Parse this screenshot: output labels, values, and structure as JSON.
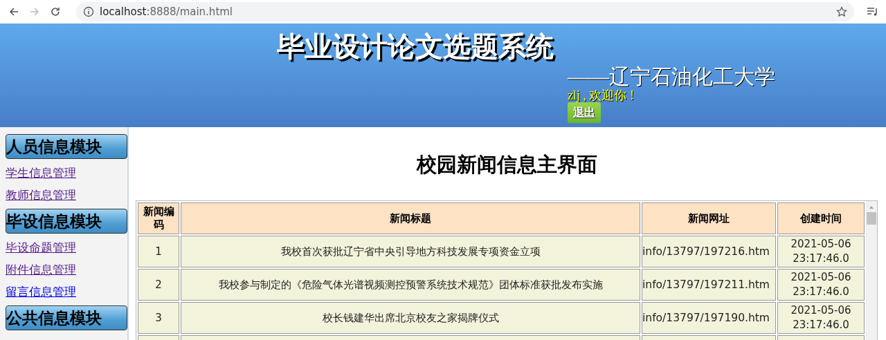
{
  "browser": {
    "url_host": "localhost",
    "url_rest": ":8888/main.html"
  },
  "header": {
    "title": "毕业设计论文选题系统",
    "subtitle": "——辽宁石油化工大学",
    "welcome": "zlj , 欢迎你 !",
    "logout": "退出"
  },
  "sidebar": {
    "sections": [
      {
        "heading": "人员信息模块",
        "links": [
          {
            "label": "学生信息管理",
            "visited": true
          },
          {
            "label": "教师信息管理",
            "visited": true
          }
        ]
      },
      {
        "heading": "毕设信息模块",
        "links": [
          {
            "label": "毕设命题管理",
            "visited": true
          },
          {
            "label": "附件信息管理",
            "visited": true
          },
          {
            "label": "留言信息管理",
            "visited": false
          }
        ]
      },
      {
        "heading": "公共信息模块"
      }
    ]
  },
  "main": {
    "title": "校园新闻信息主界面",
    "table": {
      "columns": [
        "新闻编码",
        "新闻标题",
        "新闻网址",
        "创建时间"
      ],
      "rows": [
        [
          "1",
          "我校首次获批辽宁省中央引导地方科技发展专项资金立项",
          "info/13797/197216.htm",
          "2021-05-06 23:17:46.0"
        ],
        [
          "2",
          "我校参与制定的《危险气体光谱视频测控预警系统技术规范》团体标准获批发布实施",
          "info/13797/197211.htm",
          "2021-05-06 23:17:46.0"
        ],
        [
          "3",
          "校长钱建华出席北京校友之家揭牌仪式",
          "info/13797/197190.htm",
          "2021-05-06 23:17:46.0"
        ]
      ]
    }
  }
}
